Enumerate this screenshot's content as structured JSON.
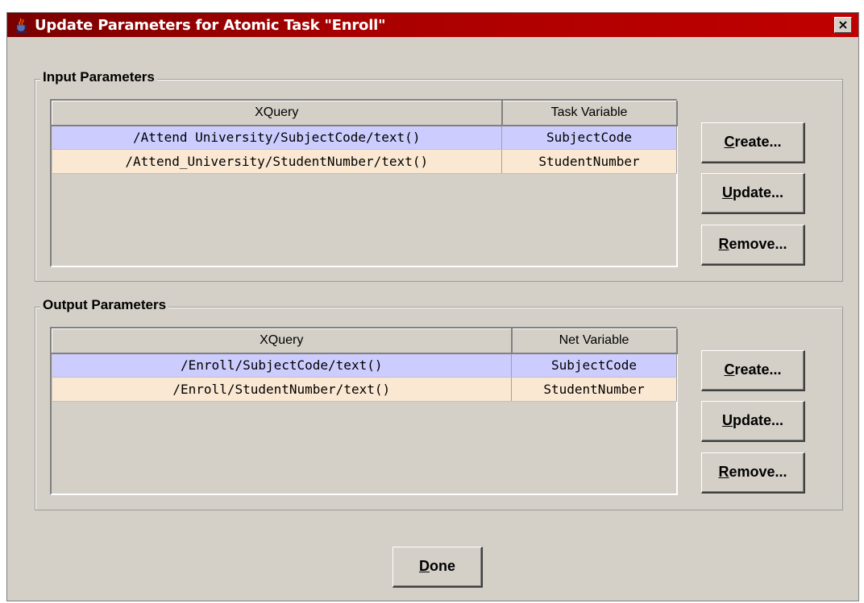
{
  "window": {
    "title": "Update Parameters for Atomic Task \"Enroll\"",
    "close_symbol": "×",
    "icon": "java-cup-icon"
  },
  "input_parameters": {
    "label": "Input Parameters",
    "columns": [
      "XQuery",
      "Task Variable"
    ],
    "rows": [
      {
        "xquery": "/Attend University/SubjectCode/text()",
        "variable": "SubjectCode"
      },
      {
        "xquery": "/Attend_University/StudentNumber/text()",
        "variable": "StudentNumber"
      }
    ],
    "buttons": {
      "create": {
        "mnemonic": "C",
        "rest": "reate..."
      },
      "update": {
        "mnemonic": "U",
        "rest": "pdate..."
      },
      "remove": {
        "mnemonic": "R",
        "rest": "emove..."
      }
    }
  },
  "output_parameters": {
    "label": "Output Parameters",
    "columns": [
      "XQuery",
      "Net Variable"
    ],
    "rows": [
      {
        "xquery": "/Enroll/SubjectCode/text()",
        "variable": "SubjectCode"
      },
      {
        "xquery": "/Enroll/StudentNumber/text()",
        "variable": "StudentNumber"
      }
    ],
    "buttons": {
      "create": {
        "mnemonic": "C",
        "rest": "reate..."
      },
      "update": {
        "mnemonic": "U",
        "rest": "pdate..."
      },
      "remove": {
        "mnemonic": "R",
        "rest": "emove..."
      }
    }
  },
  "done_button": {
    "mnemonic": "D",
    "rest": "one"
  },
  "colors": {
    "title_bar": "#a80000",
    "window_bg": "#d4d0c8",
    "row_selected": "#ccccff",
    "row_alternate": "#fbe8d2"
  }
}
